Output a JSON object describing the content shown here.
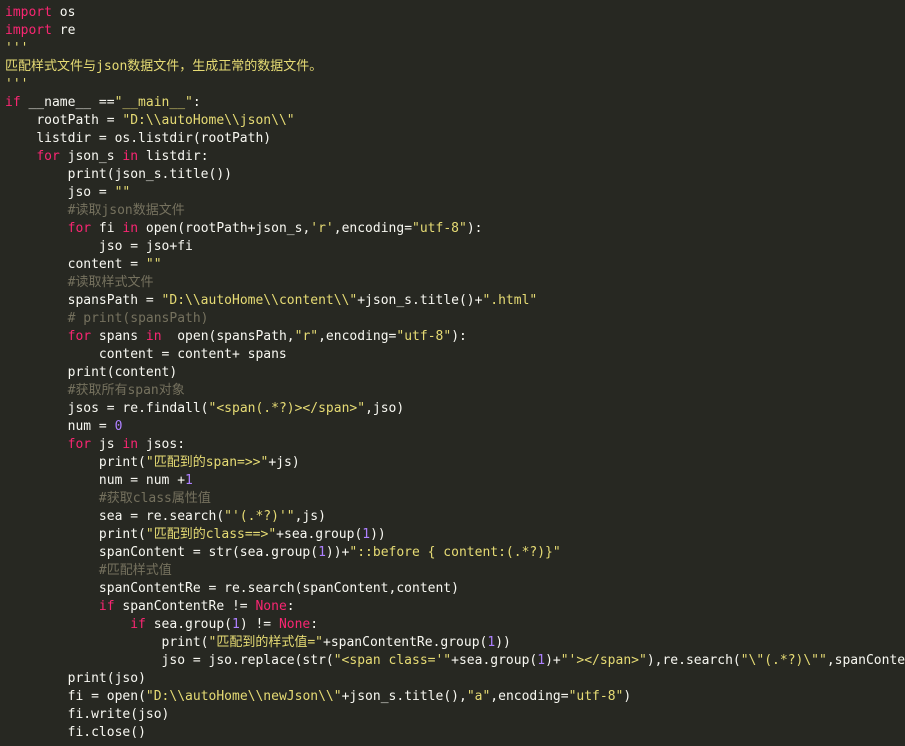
{
  "editor": {
    "indent_unit": "    ",
    "lines": [
      {
        "indent": 0,
        "tokens": [
          {
            "t": "keyword",
            "v": "import"
          },
          {
            "t": "plain",
            "v": " os"
          }
        ]
      },
      {
        "indent": 0,
        "tokens": [
          {
            "t": "keyword",
            "v": "import"
          },
          {
            "t": "plain",
            "v": " re"
          }
        ]
      },
      {
        "indent": 0,
        "tokens": [
          {
            "t": "docstring",
            "v": "'''"
          }
        ]
      },
      {
        "indent": 0,
        "tokens": [
          {
            "t": "docstring",
            "v": "匹配样式文件与json数据文件，生成正常的数据文件。"
          }
        ]
      },
      {
        "indent": 0,
        "tokens": [
          {
            "t": "docstring",
            "v": "'''"
          }
        ]
      },
      {
        "indent": 0,
        "tokens": [
          {
            "t": "keyword",
            "v": "if"
          },
          {
            "t": "plain",
            "v": " __name__ =="
          },
          {
            "t": "string",
            "v": "\"__main__\""
          },
          {
            "t": "plain",
            "v": ":"
          }
        ]
      },
      {
        "indent": 1,
        "tokens": [
          {
            "t": "plain",
            "v": "rootPath = "
          },
          {
            "t": "string",
            "v": "\"D:\\\\autoHome\\\\json\\\\\""
          }
        ]
      },
      {
        "indent": 1,
        "tokens": [
          {
            "t": "plain",
            "v": "listdir = os.listdir(rootPath)"
          }
        ]
      },
      {
        "indent": 1,
        "tokens": [
          {
            "t": "keyword",
            "v": "for"
          },
          {
            "t": "plain",
            "v": " json_s "
          },
          {
            "t": "keyword",
            "v": "in"
          },
          {
            "t": "plain",
            "v": " listdir:"
          }
        ]
      },
      {
        "indent": 2,
        "tokens": [
          {
            "t": "plain",
            "v": "print(json_s.title())"
          }
        ]
      },
      {
        "indent": 2,
        "tokens": [
          {
            "t": "plain",
            "v": "jso = "
          },
          {
            "t": "string",
            "v": "\"\""
          }
        ]
      },
      {
        "indent": 2,
        "tokens": [
          {
            "t": "comment",
            "v": "#读取json数据文件"
          }
        ]
      },
      {
        "indent": 2,
        "tokens": [
          {
            "t": "keyword",
            "v": "for"
          },
          {
            "t": "plain",
            "v": " fi "
          },
          {
            "t": "keyword",
            "v": "in"
          },
          {
            "t": "plain",
            "v": " open(rootPath+json_s,"
          },
          {
            "t": "string",
            "v": "'r'"
          },
          {
            "t": "plain",
            "v": ",encoding="
          },
          {
            "t": "string",
            "v": "\"utf-8\""
          },
          {
            "t": "plain",
            "v": "):"
          }
        ]
      },
      {
        "indent": 3,
        "tokens": [
          {
            "t": "plain",
            "v": "jso = jso+fi"
          }
        ]
      },
      {
        "indent": 2,
        "tokens": [
          {
            "t": "plain",
            "v": "content = "
          },
          {
            "t": "string",
            "v": "\"\""
          }
        ]
      },
      {
        "indent": 2,
        "tokens": [
          {
            "t": "comment",
            "v": "#读取样式文件"
          }
        ]
      },
      {
        "indent": 2,
        "tokens": [
          {
            "t": "plain",
            "v": "spansPath = "
          },
          {
            "t": "string",
            "v": "\"D:\\\\autoHome\\\\content\\\\\""
          },
          {
            "t": "plain",
            "v": "+json_s.title()+"
          },
          {
            "t": "string",
            "v": "\".html\""
          }
        ]
      },
      {
        "indent": 2,
        "tokens": [
          {
            "t": "comment",
            "v": "# print(spansPath)"
          }
        ]
      },
      {
        "indent": 2,
        "tokens": [
          {
            "t": "keyword",
            "v": "for"
          },
          {
            "t": "plain",
            "v": " spans "
          },
          {
            "t": "keyword",
            "v": "in"
          },
          {
            "t": "plain",
            "v": "  open(spansPath,"
          },
          {
            "t": "string",
            "v": "\"r\""
          },
          {
            "t": "plain",
            "v": ",encoding="
          },
          {
            "t": "string",
            "v": "\"utf-8\""
          },
          {
            "t": "plain",
            "v": "):"
          }
        ]
      },
      {
        "indent": 3,
        "tokens": [
          {
            "t": "plain",
            "v": "content = content+ spans"
          }
        ]
      },
      {
        "indent": 2,
        "tokens": [
          {
            "t": "plain",
            "v": "print(content)"
          }
        ]
      },
      {
        "indent": 2,
        "tokens": [
          {
            "t": "comment",
            "v": "#获取所有span对象"
          }
        ]
      },
      {
        "indent": 2,
        "tokens": [
          {
            "t": "plain",
            "v": "jsos = re.findall("
          },
          {
            "t": "string",
            "v": "\"<span(.*?)></span>\""
          },
          {
            "t": "plain",
            "v": ",jso)"
          }
        ]
      },
      {
        "indent": 2,
        "tokens": [
          {
            "t": "plain",
            "v": "num = "
          },
          {
            "t": "number",
            "v": "0"
          }
        ]
      },
      {
        "indent": 2,
        "tokens": [
          {
            "t": "keyword",
            "v": "for"
          },
          {
            "t": "plain",
            "v": " js "
          },
          {
            "t": "keyword",
            "v": "in"
          },
          {
            "t": "plain",
            "v": " jsos:"
          }
        ]
      },
      {
        "indent": 3,
        "tokens": [
          {
            "t": "plain",
            "v": "print("
          },
          {
            "t": "string",
            "v": "\"匹配到的span=>>\""
          },
          {
            "t": "plain",
            "v": "+js)"
          }
        ]
      },
      {
        "indent": 3,
        "tokens": [
          {
            "t": "plain",
            "v": "num = num +"
          },
          {
            "t": "number",
            "v": "1"
          }
        ]
      },
      {
        "indent": 3,
        "tokens": [
          {
            "t": "comment",
            "v": "#获取class属性值"
          }
        ]
      },
      {
        "indent": 3,
        "tokens": [
          {
            "t": "plain",
            "v": "sea = re.search("
          },
          {
            "t": "string",
            "v": "\"'(.*?)'\""
          },
          {
            "t": "plain",
            "v": ",js)"
          }
        ]
      },
      {
        "indent": 3,
        "tokens": [
          {
            "t": "plain",
            "v": "print("
          },
          {
            "t": "string",
            "v": "\"匹配到的class==>\""
          },
          {
            "t": "plain",
            "v": "+sea.group("
          },
          {
            "t": "number",
            "v": "1"
          },
          {
            "t": "plain",
            "v": "))"
          }
        ]
      },
      {
        "indent": 3,
        "tokens": [
          {
            "t": "plain",
            "v": "spanContent = str(sea.group("
          },
          {
            "t": "number",
            "v": "1"
          },
          {
            "t": "plain",
            "v": "))+"
          },
          {
            "t": "string",
            "v": "\"::before { content:(.*?)}\""
          }
        ]
      },
      {
        "indent": 3,
        "tokens": [
          {
            "t": "comment",
            "v": "#匹配样式值"
          }
        ]
      },
      {
        "indent": 3,
        "tokens": [
          {
            "t": "plain",
            "v": "spanContentRe = re.search(spanContent,content)"
          }
        ]
      },
      {
        "indent": 3,
        "tokens": [
          {
            "t": "keyword",
            "v": "if"
          },
          {
            "t": "plain",
            "v": " spanContentRe != "
          },
          {
            "t": "keyword",
            "v": "None"
          },
          {
            "t": "plain",
            "v": ":"
          }
        ]
      },
      {
        "indent": 4,
        "tokens": [
          {
            "t": "keyword",
            "v": "if"
          },
          {
            "t": "plain",
            "v": " sea.group("
          },
          {
            "t": "number",
            "v": "1"
          },
          {
            "t": "plain",
            "v": ") != "
          },
          {
            "t": "keyword",
            "v": "None"
          },
          {
            "t": "plain",
            "v": ":"
          }
        ]
      },
      {
        "indent": 5,
        "tokens": [
          {
            "t": "plain",
            "v": "print("
          },
          {
            "t": "string",
            "v": "\"匹配到的样式值=\""
          },
          {
            "t": "plain",
            "v": "+spanContentRe.group("
          },
          {
            "t": "number",
            "v": "1"
          },
          {
            "t": "plain",
            "v": "))"
          }
        ]
      },
      {
        "indent": 5,
        "tokens": [
          {
            "t": "plain",
            "v": "jso = jso.replace(str("
          },
          {
            "t": "string",
            "v": "\"<span class='\""
          },
          {
            "t": "plain",
            "v": "+sea.group("
          },
          {
            "t": "number",
            "v": "1"
          },
          {
            "t": "plain",
            "v": ")+"
          },
          {
            "t": "string",
            "v": "\"'></span>\""
          },
          {
            "t": "plain",
            "v": "),re.search("
          },
          {
            "t": "string",
            "v": "\"\\\"(.*?)\\\"\""
          },
          {
            "t": "plain",
            "v": ",spanContent"
          }
        ]
      },
      {
        "indent": 2,
        "tokens": [
          {
            "t": "plain",
            "v": "print(jso)"
          }
        ]
      },
      {
        "indent": 2,
        "tokens": [
          {
            "t": "plain",
            "v": "fi = open("
          },
          {
            "t": "string",
            "v": "\"D:\\\\autoHome\\\\newJson\\\\\""
          },
          {
            "t": "plain",
            "v": "+json_s.title(),"
          },
          {
            "t": "string",
            "v": "\"a\""
          },
          {
            "t": "plain",
            "v": ",encoding="
          },
          {
            "t": "string",
            "v": "\"utf-8\""
          },
          {
            "t": "plain",
            "v": ")"
          }
        ]
      },
      {
        "indent": 2,
        "tokens": [
          {
            "t": "plain",
            "v": "fi.write(jso)"
          }
        ]
      },
      {
        "indent": 2,
        "tokens": [
          {
            "t": "plain",
            "v": "fi.close()"
          }
        ]
      }
    ]
  },
  "colors": {
    "background": "#272822",
    "keyword": "#f92672",
    "string": "#e6db74",
    "number": "#ae81ff",
    "comment": "#75715e",
    "plain": "#f8f8f2"
  }
}
